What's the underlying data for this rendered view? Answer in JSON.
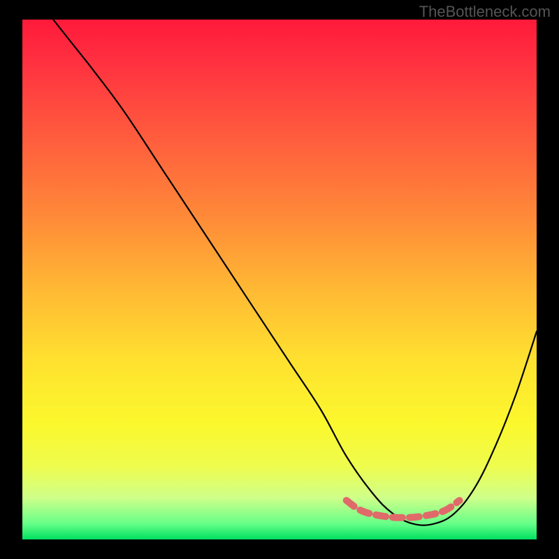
{
  "watermark": "TheBottleneck.com",
  "chart_data": {
    "type": "line",
    "title": "",
    "xlabel": "",
    "ylabel": "",
    "xlim": [
      0,
      100
    ],
    "ylim": [
      0,
      100
    ],
    "gradient_colors": {
      "top": "#ff1a3a",
      "mid_upper": "#ff8a38",
      "mid": "#ffe22f",
      "mid_lower": "#eefc4e",
      "bottom": "#00e060"
    },
    "series": [
      {
        "name": "bottleneck-curve",
        "color": "#000000",
        "x": [
          6,
          10,
          14,
          20,
          28,
          36,
          44,
          52,
          58,
          63,
          68,
          72,
          76,
          80,
          84,
          88,
          92,
          96,
          100
        ],
        "y": [
          100,
          95,
          90,
          82,
          70,
          58,
          46,
          34,
          25,
          16,
          9,
          5,
          3,
          3,
          5,
          10,
          18,
          28,
          40
        ]
      },
      {
        "name": "optimal-range-marker",
        "color": "#e06a6a",
        "x": [
          63,
          66,
          70,
          74,
          78,
          82,
          85
        ],
        "y": [
          7.5,
          5.5,
          4.5,
          4.2,
          4.5,
          5.5,
          7.5
        ]
      }
    ]
  }
}
